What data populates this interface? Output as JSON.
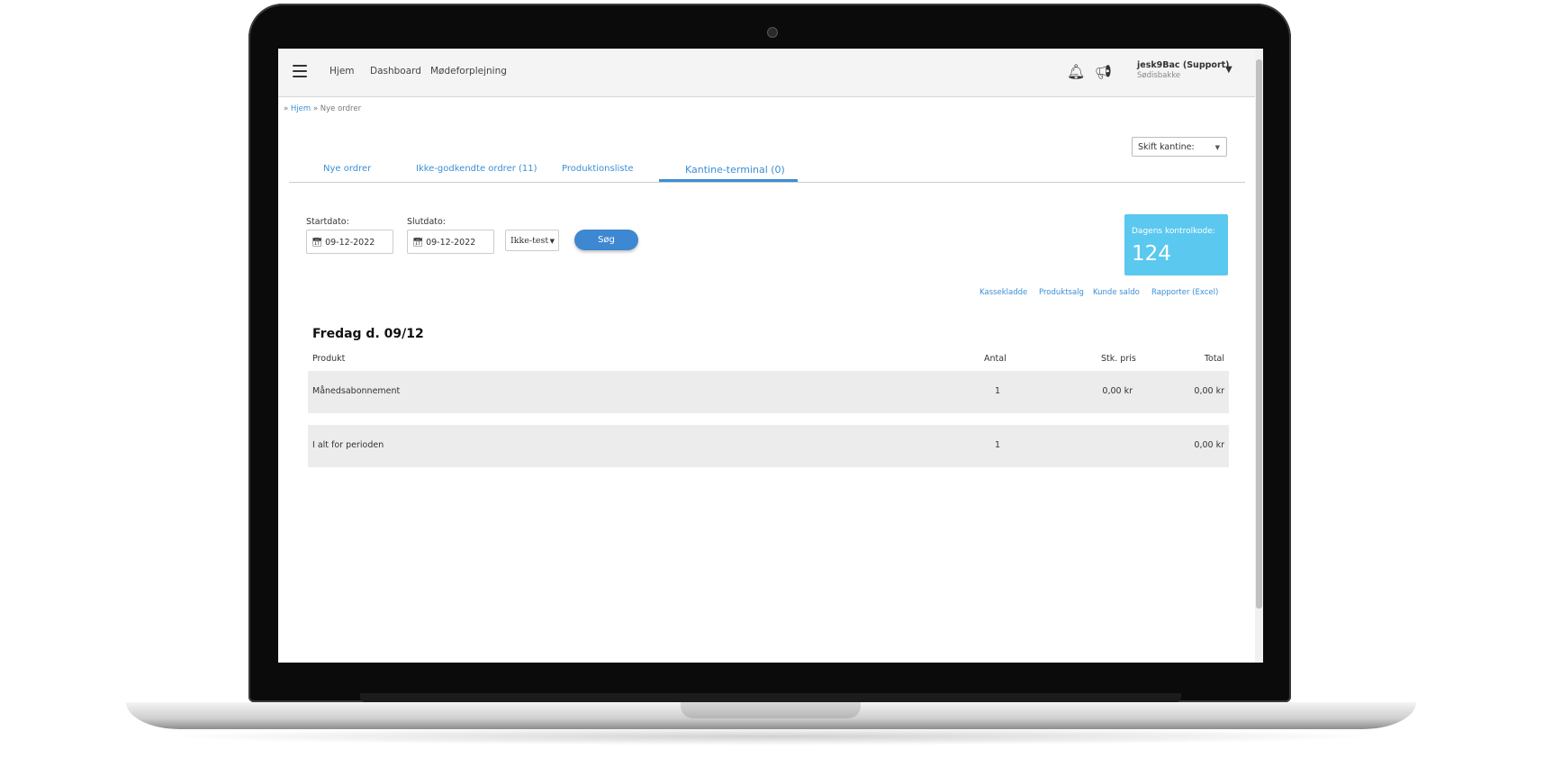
{
  "nav": {
    "links": [
      "Hjem",
      "Dashboard",
      "Mødeforplejning"
    ]
  },
  "user": {
    "name": "jesk9Bac (Support)",
    "location": "Sødisbakke"
  },
  "breadcrumb": {
    "prefix": "»",
    "home": "Hjem",
    "current": "» Nye ordrer"
  },
  "kantine_select": {
    "label": "Skift kantine:"
  },
  "tabs": [
    {
      "label": "Nye ordrer"
    },
    {
      "label": "Ikke-godkendte ordrer (11)"
    },
    {
      "label": "Produktionsliste"
    },
    {
      "label": "Kantine-terminal (0)"
    }
  ],
  "filters": {
    "start_label": "Startdato:",
    "start_value": "09-12-2022",
    "end_label": "Slutdato:",
    "end_value": "09-12-2022",
    "test_value": "Ikke-test",
    "search_label": "Søg"
  },
  "kode": {
    "label": "Dagens kontrolkode:",
    "value": "124"
  },
  "links": [
    "Kassekladde",
    "Produktsalg",
    "Kunde saldo",
    "Rapporter (Excel)"
  ],
  "day": {
    "title": "Fredag d. 09/12"
  },
  "table": {
    "headers": {
      "product": "Produkt",
      "qty": "Antal",
      "price": "Stk. pris",
      "total": "Total"
    },
    "rows": [
      {
        "product": "Månedsabonnement",
        "qty": "1",
        "price": "0,00 kr",
        "total": "0,00 kr"
      }
    ],
    "summary": {
      "label": "I alt for perioden",
      "qty": "1",
      "total": "0,00 kr"
    }
  },
  "icons": {
    "menu": "hamburger-icon",
    "bell": "bell-icon",
    "megaphone": "megaphone-icon",
    "calendar": "calendar-icon",
    "caret": "caret-down-icon"
  },
  "colors": {
    "accent": "#3b8fd6",
    "button": "#3e87d1",
    "kode_box": "#5bc8f0",
    "row_bg": "#ececec"
  }
}
